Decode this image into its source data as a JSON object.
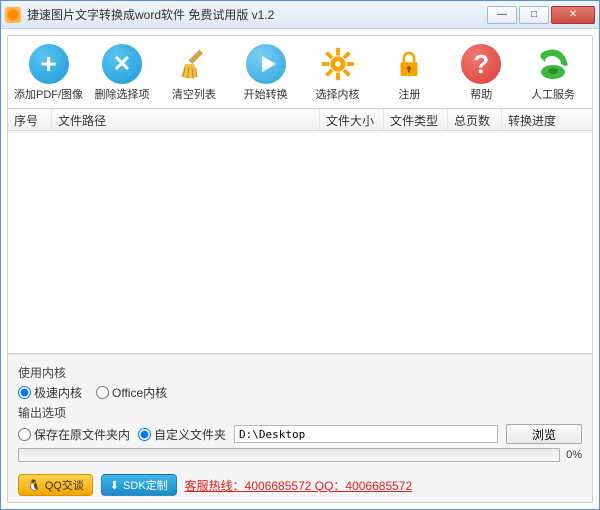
{
  "window": {
    "title": "捷速图片文字转换成word软件 免费试用版 v1.2"
  },
  "toolbar": {
    "add": "添加PDF/图像",
    "delete": "删除选择项",
    "clear": "清空列表",
    "start": "开始转换",
    "engine": "选择内核",
    "register": "注册",
    "help": "帮助",
    "service": "人工服务"
  },
  "columns": {
    "seq": "序号",
    "path": "文件路径",
    "size": "文件大小",
    "type": "文件类型",
    "pages": "总页数",
    "progress": "转换进度"
  },
  "engine": {
    "label": "使用内核",
    "fast": "极速内核",
    "office": "Office内核"
  },
  "output": {
    "label": "输出选项",
    "same_folder": "保存在原文件夹内",
    "custom_folder": "自定义文件夹",
    "path": "D:\\Desktop",
    "browse": "浏览"
  },
  "progress": {
    "value": "0%"
  },
  "footer": {
    "qq": "QQ交谈",
    "sdk": "SDK定制",
    "hotline": "客服热线：4006685572 QQ：4006685572"
  }
}
